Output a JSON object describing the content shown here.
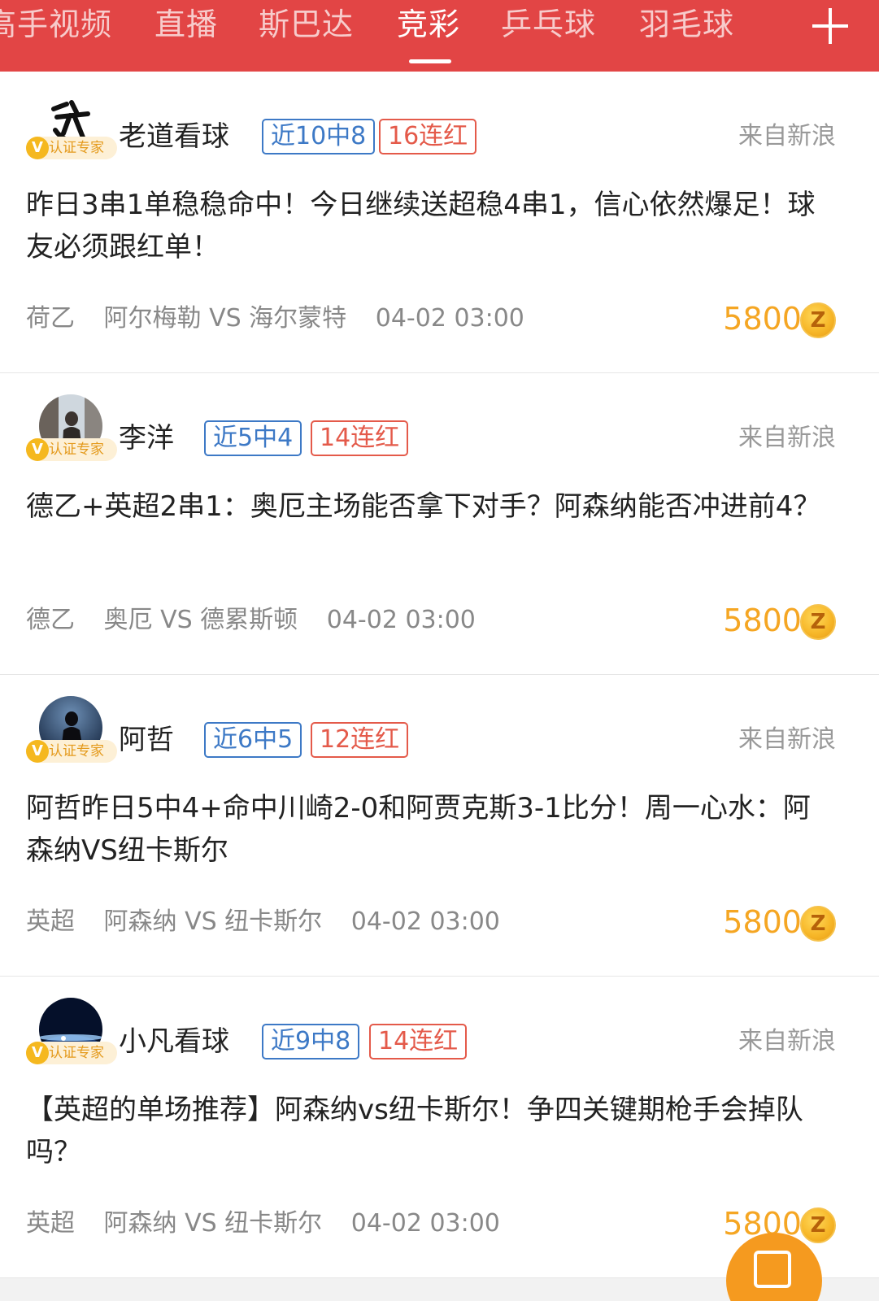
{
  "tabs": [
    {
      "label": "高手视频"
    },
    {
      "label": "直播"
    },
    {
      "label": "斯巴达"
    },
    {
      "label": "竞彩",
      "active": true
    },
    {
      "label": "乒乓球"
    },
    {
      "label": "羽毛球"
    }
  ],
  "add_icon": "plus-icon",
  "verify_label": "认证专家",
  "verify_icon": "V",
  "coin_glyph": "Z",
  "posts": [
    {
      "author": "老道看球",
      "avatar_icon": "calligraphy-avatar",
      "record": "近10中8",
      "streak": "16连红",
      "source": "来自新浪",
      "title": "昨日3串1单稳稳命中！今日继续送超稳4串1，信心依然爆足！球友必须跟红单！",
      "league": "荷乙",
      "match": "阿尔梅勒 VS 海尔蒙特",
      "time": "04-02 03:00",
      "price": "5800"
    },
    {
      "author": "李洋",
      "avatar_icon": "photo-avatar",
      "record": "近5中4",
      "streak": "14连红",
      "source": "来自新浪",
      "title": "德乙+英超2串1：奥厄主场能否拿下对手？阿森纳能否冲进前4？",
      "league": "德乙",
      "match": "奥厄 VS 德累斯顿",
      "time": "04-02 03:00",
      "price": "5800"
    },
    {
      "author": "阿哲",
      "avatar_icon": "silhouette-avatar",
      "record": "近6中5",
      "streak": "12连红",
      "source": "来自新浪",
      "title": "阿哲昨日5中4+命中川崎2-0和阿贾克斯3-1比分！周一心水：阿森纳VS纽卡斯尔",
      "league": "英超",
      "match": "阿森纳 VS 纽卡斯尔",
      "time": "04-02 03:00",
      "price": "5800"
    },
    {
      "author": "小凡看球",
      "avatar_icon": "earth-avatar",
      "record": "近9中8",
      "streak": "14连红",
      "source": "来自新浪",
      "title": "【英超的单场推荐】阿森纳vs纽卡斯尔！争四关键期枪手会掉队吗？",
      "league": "英超",
      "match": "阿森纳 VS 纽卡斯尔",
      "time": "04-02 03:00",
      "price": "5800"
    }
  ],
  "colors": {
    "header_bg": "#e24545",
    "badge_blue": "#3d79c6",
    "badge_red": "#e45a4a",
    "price": "#f5a623",
    "verify": "#f5b81f"
  },
  "fab_icon": "shopping-bag-icon"
}
